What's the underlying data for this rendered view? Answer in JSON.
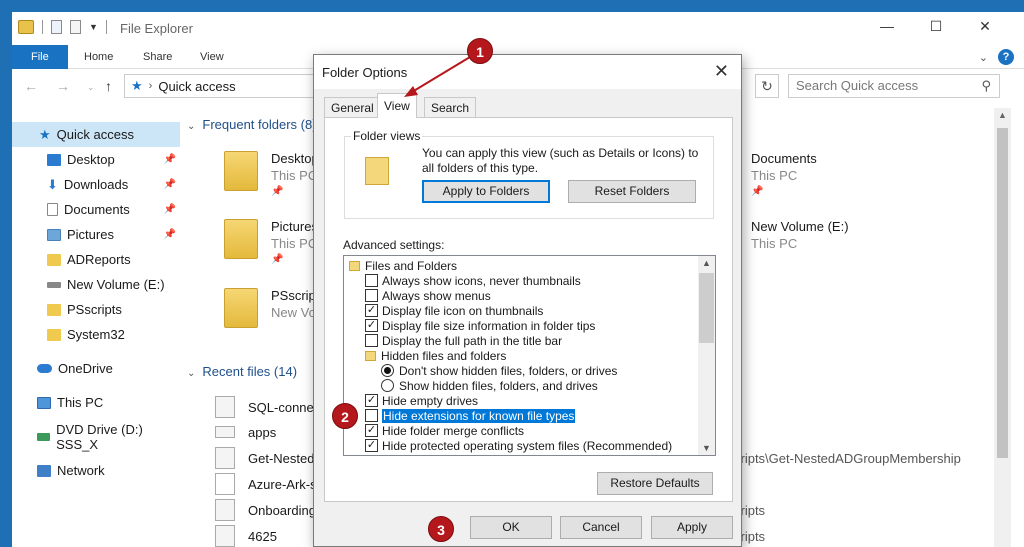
{
  "explorer": {
    "title": "File Explorer",
    "ribbon": {
      "tabs": [
        "File",
        "Home",
        "Share",
        "View"
      ]
    },
    "address": {
      "text": "Quick access",
      "search_placeholder": "Search Quick access"
    },
    "sidebar": {
      "items": [
        {
          "label": "Quick access",
          "icon": "star-icon",
          "pinned": false
        },
        {
          "label": "Desktop",
          "icon": "desktop-icon",
          "pinned": true
        },
        {
          "label": "Downloads",
          "icon": "download-icon",
          "pinned": true
        },
        {
          "label": "Documents",
          "icon": "documents-icon",
          "pinned": true
        },
        {
          "label": "Pictures",
          "icon": "pictures-icon",
          "pinned": true
        },
        {
          "label": "ADReports",
          "icon": "folder-icon",
          "pinned": false
        },
        {
          "label": "New Volume (E:)",
          "icon": "drive-icon",
          "pinned": false
        },
        {
          "label": "PSscripts",
          "icon": "folder-icon",
          "pinned": false
        },
        {
          "label": "System32",
          "icon": "folder-icon",
          "pinned": false
        },
        {
          "label": "OneDrive",
          "icon": "cloud-icon",
          "pinned": false
        },
        {
          "label": "This PC",
          "icon": "computer-icon",
          "pinned": false
        },
        {
          "label": "DVD Drive (D:) SSS_X",
          "icon": "dvd-icon",
          "pinned": false
        },
        {
          "label": "Network",
          "icon": "network-icon",
          "pinned": false
        }
      ]
    },
    "frequent": {
      "header": "Frequent folders (8)",
      "tiles": [
        {
          "name": "Desktop",
          "sub": "This PC"
        },
        {
          "name": "Pictures",
          "sub": "This PC"
        },
        {
          "name": "PSscript",
          "sub": "New Vol"
        },
        {
          "name": "Documents",
          "sub": "This PC"
        },
        {
          "name": "New Volume (E:)",
          "sub": "This PC"
        }
      ]
    },
    "recent": {
      "header": "Recent files (14)",
      "files": [
        "SQL-conne",
        "apps",
        "Get-Nested",
        "Azure-Ark-s",
        "Onboarding",
        "4625"
      ],
      "right_paths": [
        "cripts\\Get-NestedADGroupMembership",
        "cripts",
        "cripts"
      ]
    }
  },
  "dialog": {
    "title": "Folder Options",
    "tabs": [
      "General",
      "View",
      "Search"
    ],
    "active_tab": "View",
    "folder_views": {
      "legend": "Folder views",
      "description": "You can apply this view (such as Details or Icons) to all folders of this type.",
      "apply_button": "Apply to Folders",
      "reset_button": "Reset Folders"
    },
    "advanced_label": "Advanced settings:",
    "advanced": [
      {
        "type": "folder",
        "label": "Files and Folders"
      },
      {
        "type": "check",
        "checked": false,
        "label": "Always show icons, never thumbnails"
      },
      {
        "type": "check",
        "checked": false,
        "label": "Always show menus"
      },
      {
        "type": "check",
        "checked": true,
        "label": "Display file icon on thumbnails"
      },
      {
        "type": "check",
        "checked": true,
        "label": "Display file size information in folder tips"
      },
      {
        "type": "check",
        "checked": false,
        "label": "Display the full path in the title bar"
      },
      {
        "type": "folder",
        "label": "Hidden files and folders"
      },
      {
        "type": "radio",
        "checked": true,
        "label": "Don't show hidden files, folders, or drives"
      },
      {
        "type": "radio",
        "checked": false,
        "label": "Show hidden files, folders, and drives"
      },
      {
        "type": "check",
        "checked": true,
        "label": "Hide empty drives"
      },
      {
        "type": "check",
        "checked": false,
        "label": "Hide extensions for known file types",
        "highlighted": true
      },
      {
        "type": "check",
        "checked": true,
        "label": "Hide folder merge conflicts"
      },
      {
        "type": "check",
        "checked": true,
        "label": "Hide protected operating system files (Recommended)"
      }
    ],
    "restore_button": "Restore Defaults",
    "ok_button": "OK",
    "cancel_button": "Cancel",
    "apply_button": "Apply"
  },
  "annotations": {
    "badge1": "1",
    "badge2": "2",
    "badge3": "3",
    "color": "#b5181c"
  }
}
